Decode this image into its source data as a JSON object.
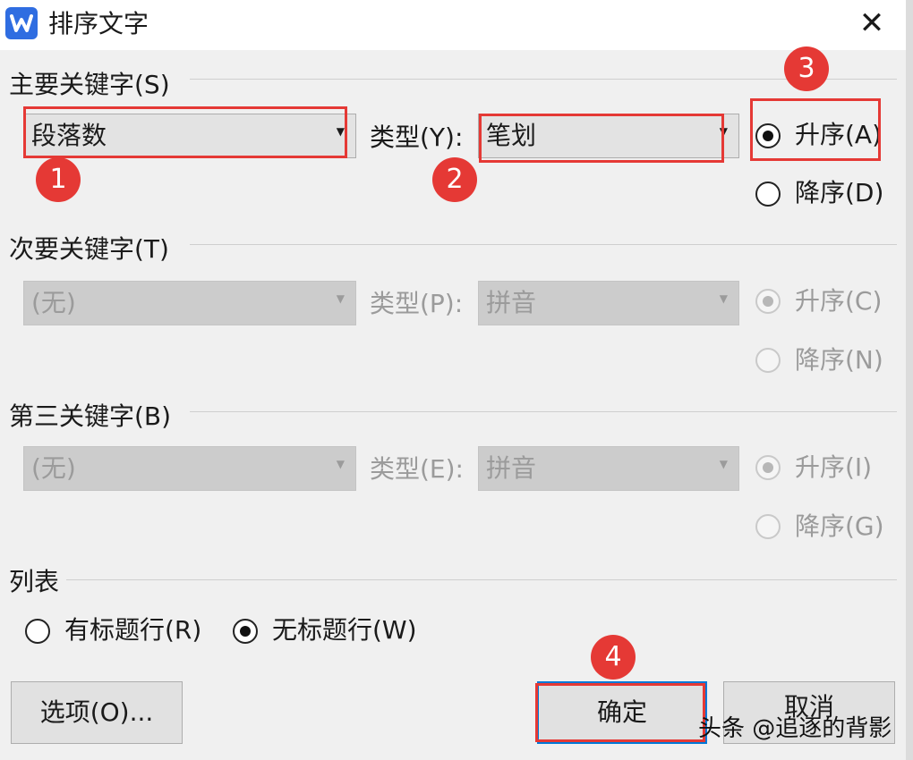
{
  "window": {
    "title": "排序文字"
  },
  "primary_key": {
    "label": "主要关键字(S)",
    "field_value": "段落数",
    "type_label": "类型(Y):",
    "type_value": "笔划",
    "asc_label": "升序(A)",
    "desc_label": "降序(D)",
    "selected": "asc"
  },
  "secondary_key": {
    "label": "次要关键字(T)",
    "field_value": "(无)",
    "type_label": "类型(P):",
    "type_value": "拼音",
    "asc_label": "升序(C)",
    "desc_label": "降序(N)",
    "selected": "asc",
    "disabled": true
  },
  "tertiary_key": {
    "label": "第三关键字(B)",
    "field_value": "(无)",
    "type_label": "类型(E):",
    "type_value": "拼音",
    "asc_label": "升序(I)",
    "desc_label": "降序(G)",
    "selected": "asc",
    "disabled": true
  },
  "list": {
    "label": "列表",
    "header_row_label": "有标题行(R)",
    "no_header_row_label": "无标题行(W)",
    "selected": "no_header"
  },
  "buttons": {
    "options": "选项(O)...",
    "ok": "确定",
    "cancel": "取消"
  },
  "annotations": {
    "badge_1": "1",
    "badge_2": "2",
    "badge_3": "3",
    "badge_4": "4",
    "highlight_color": "#e53935"
  },
  "watermark": "头条 @追逐的背影",
  "icons": {
    "app": "wps-writer-icon",
    "close": "close-icon",
    "dropdown": "triangle-down-icon"
  }
}
